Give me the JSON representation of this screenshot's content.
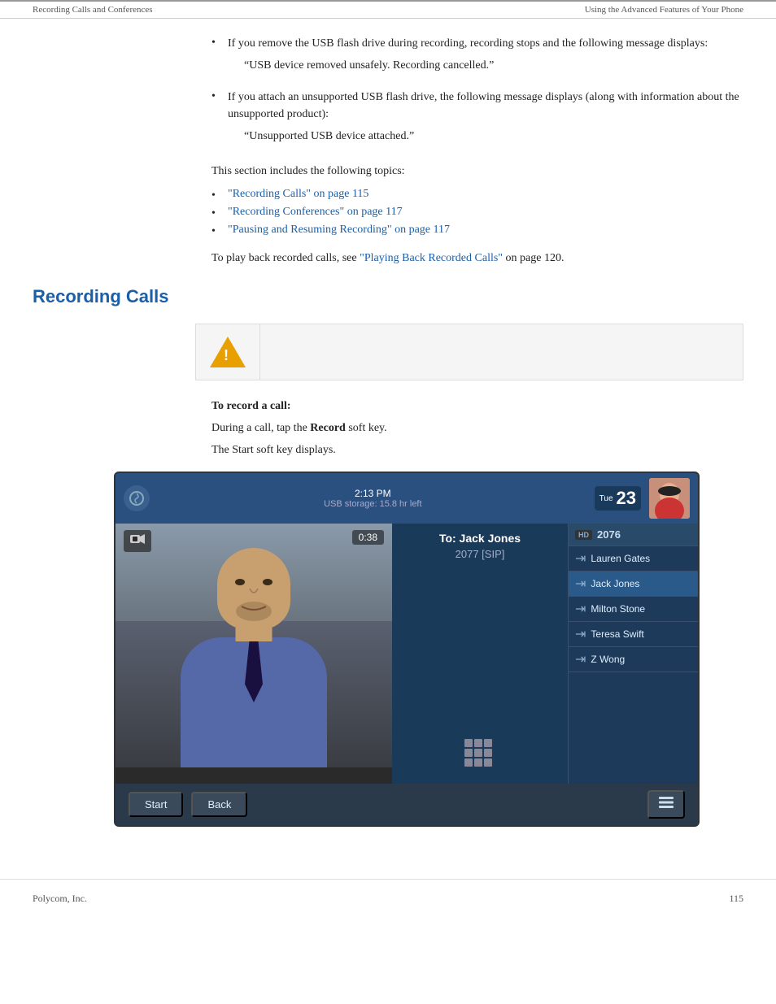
{
  "header": {
    "left": "Recording Calls and Conferences",
    "right": "Using the Advanced Features of Your Phone"
  },
  "bullets": [
    {
      "text": "If you remove the USB flash drive during recording, recording stops and the following message displays:",
      "quote": "“USB device removed unsafely. Recording cancelled.”"
    },
    {
      "text": "If you attach an unsupported USB flash drive, the following message displays (along with information about the unsupported product):",
      "quote": "“Unsupported USB device attached.”"
    }
  ],
  "section_intro": "This section includes the following topics:",
  "toc_items": [
    {
      "label": "“Recording Calls” on page 115"
    },
    {
      "label": "“Recording Conferences” on page 117"
    },
    {
      "label": "“Pausing and Resuming Recording” on page 117"
    }
  ],
  "playback_line": "To play back recorded calls, see “Playing Back Recorded Calls” on page 120.",
  "section_heading": "Recording Calls",
  "procedure_heading": "To record a call:",
  "procedure_steps": [
    {
      "text": "During a call, tap the Record soft key."
    },
    {
      "text": "The Start soft key displays."
    }
  ],
  "phone": {
    "time": "2:13 PM",
    "date_day": "Tue",
    "date_num": "23",
    "usb_storage": "USB storage: 15.8 hr left",
    "video_timer": "0:38",
    "call_to": "To: Jack Jones",
    "call_number": "2077 [SIP]",
    "ext_number": "2076",
    "contacts": [
      {
        "name": "Lauren Gates",
        "active": false
      },
      {
        "name": "Jack Jones",
        "active": true
      },
      {
        "name": "Milton Stone",
        "active": false
      },
      {
        "name": "Teresa Swift",
        "active": false
      },
      {
        "name": "Z Wong",
        "active": false
      }
    ],
    "soft_keys": {
      "start": "Start",
      "back": "Back"
    }
  },
  "footer": {
    "company": "Polycom, Inc.",
    "page": "115"
  }
}
